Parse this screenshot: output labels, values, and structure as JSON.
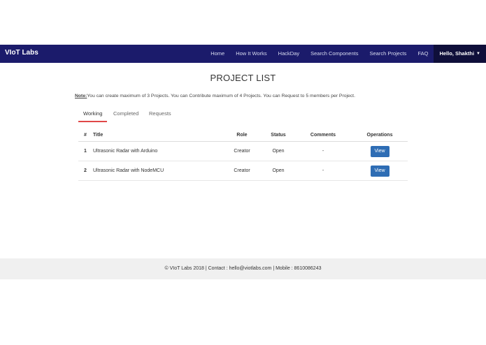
{
  "navbar": {
    "brand": "VIoT Labs",
    "links": [
      "Home",
      "How It Works",
      "HackDay",
      "Search Components",
      "Search Projects",
      "FAQ"
    ],
    "user": "Hello, Shakthi"
  },
  "page": {
    "title": "PROJECT LIST",
    "note_label": "Note:",
    "note_text": "You can create maximum of 3 Projects. You can Contribute maximum of 4 Projects. You can Request to 5 members per Project."
  },
  "tabs": [
    {
      "label": "Working",
      "active": true
    },
    {
      "label": "Completed",
      "active": false
    },
    {
      "label": "Requests",
      "active": false
    }
  ],
  "table": {
    "headers": [
      "#",
      "Title",
      "Role",
      "Status",
      "Comments",
      "Operations"
    ],
    "rows": [
      {
        "num": "1",
        "title": "Ultrasonic Radar with Arduino",
        "role": "Creator",
        "status": "Open",
        "comments": "-",
        "action": "View"
      },
      {
        "num": "2",
        "title": "Ultrasonic Radar with NodeMCU",
        "role": "Creator",
        "status": "Open",
        "comments": "-",
        "action": "View"
      }
    ]
  },
  "footer": {
    "text": "© VIoT Labs 2018 | Contact : hello@viotlabs.com | Mobile : 8610086243"
  },
  "colors": {
    "navbar": "#1b1b6b",
    "accent_tab": "#e04848",
    "button": "#2e6db4"
  }
}
